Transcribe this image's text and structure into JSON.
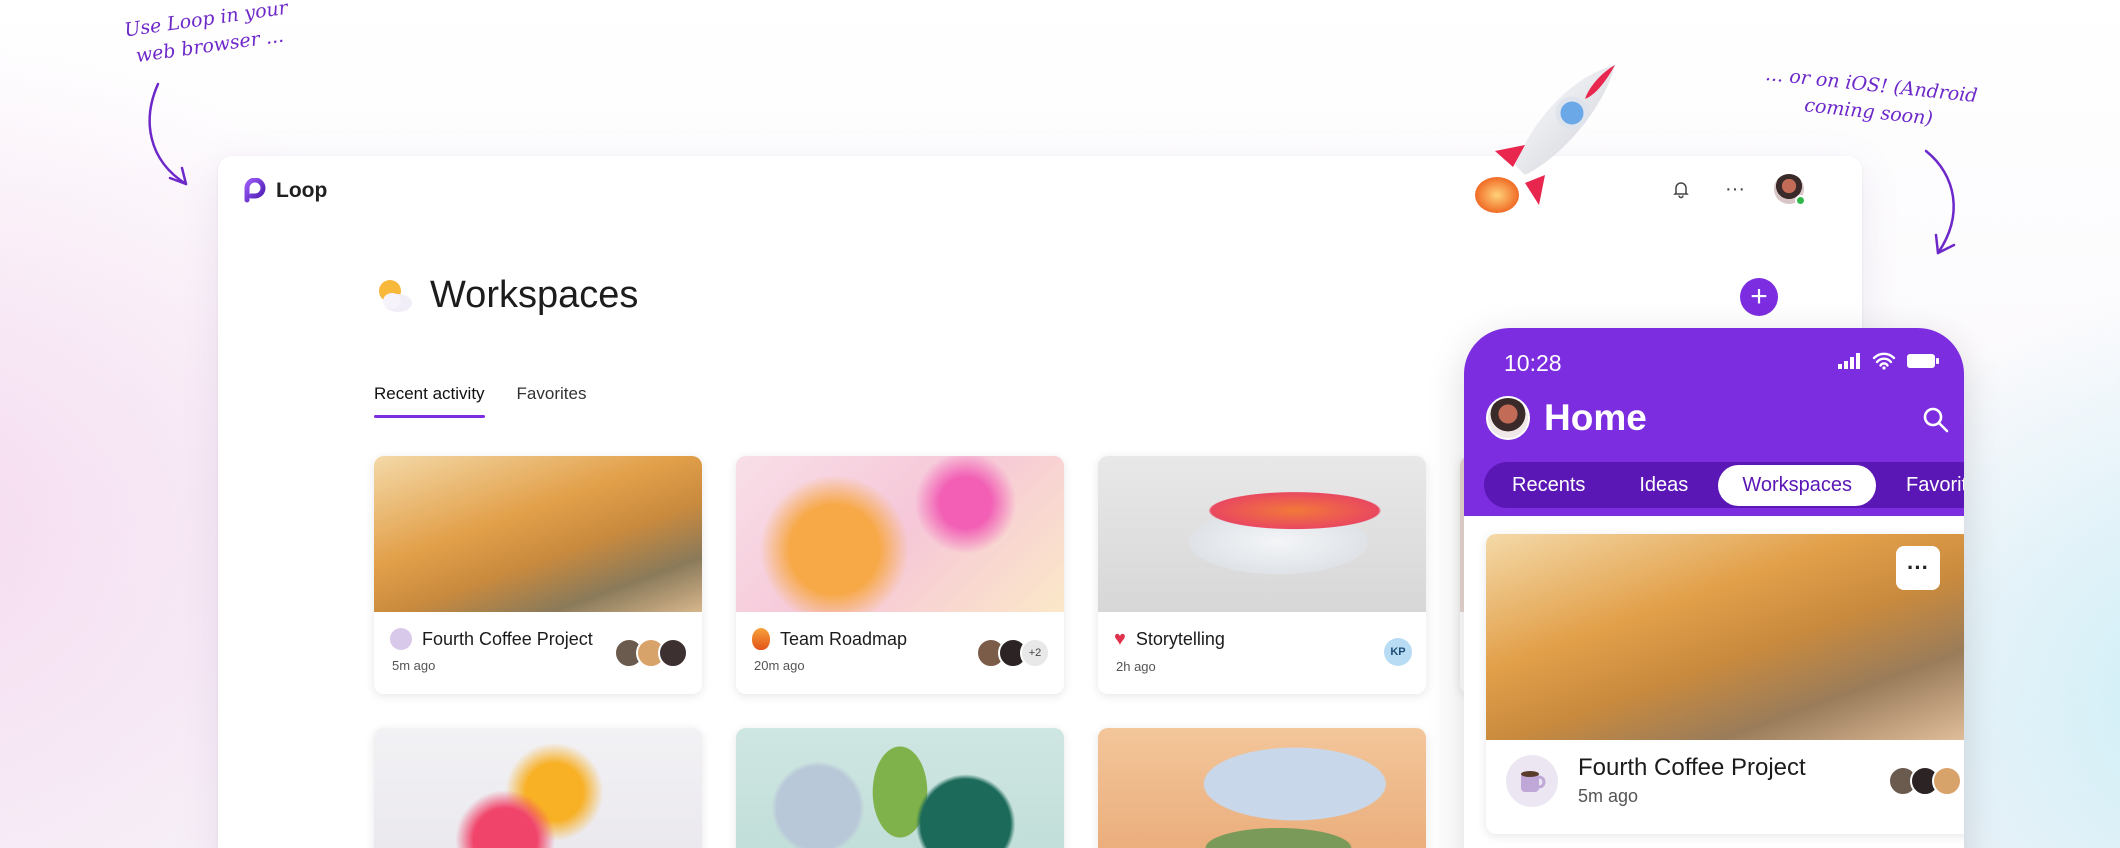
{
  "annotations": {
    "left": "Use Loop in your web browser ...",
    "right": "... or on iOS! (Android coming soon)"
  },
  "browser": {
    "app_name": "Loop",
    "page_title": "Workspaces",
    "tabs": [
      "Recent activity",
      "Favorites"
    ],
    "active_tab": "Recent activity",
    "cards": [
      {
        "title": "Fourth Coffee Project",
        "time": "5m ago",
        "icon": "coffee-icon"
      },
      {
        "title": "Team Roadmap",
        "time": "20m ago",
        "icon": "fire-icon",
        "extra": "+2"
      },
      {
        "title": "Storytelling",
        "time": "2h ago",
        "icon": "heart-icon",
        "initials": "KP"
      }
    ],
    "accent": "#7d2de0"
  },
  "phone": {
    "time": "10:28",
    "title": "Home",
    "tabs": [
      "Recents",
      "Ideas",
      "Workspaces",
      "Favorites"
    ],
    "active_tab": "Workspaces",
    "card": {
      "title": "Fourth Coffee Project",
      "time": "5m ago"
    },
    "header_color": "#7d2de0"
  }
}
